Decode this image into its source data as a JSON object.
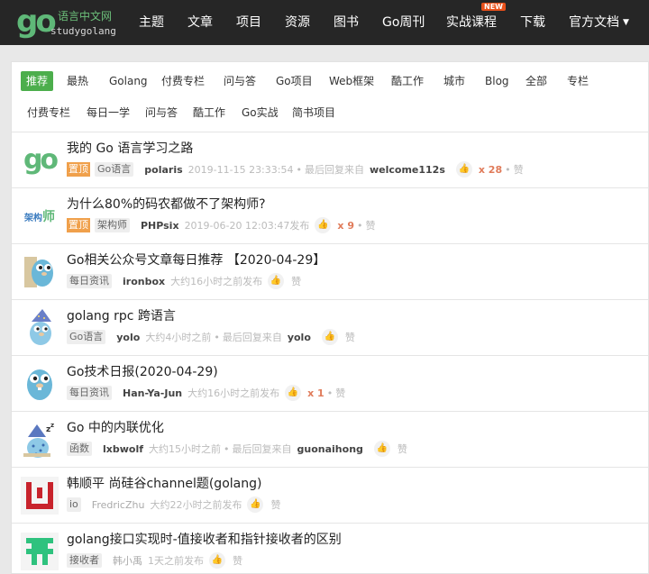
{
  "brand": {
    "logo_mark": "go",
    "name_cn": "语言中文网",
    "name_en": "studygolang"
  },
  "nav": {
    "items": [
      "主题",
      "文章",
      "项目",
      "资源",
      "图书",
      "Go周刊",
      "实战课程",
      "下载",
      "官方文档"
    ],
    "new_badge": "NEW"
  },
  "tabs_primary": [
    "推荐",
    "最热",
    "Golang",
    "付费专栏",
    "问与答",
    "Go项目",
    "Web框架",
    "酷工作",
    "城市",
    "Blog",
    "全部",
    "专栏"
  ],
  "tabs_secondary": [
    "付费专栏",
    "每日一学",
    "问与答",
    "酷工作",
    "Go实战",
    "简书项目"
  ],
  "topics": [
    {
      "avatar": "go-logo-avatar",
      "title": "我的 Go 语言学习之路",
      "pinned": "置顶",
      "node": "Go语言",
      "author": "polaris",
      "time": "2019-11-15 23:33:54",
      "sep": "•",
      "status": "最后回复来自",
      "last_reply": "welcome112s",
      "likes": "x 28",
      "zan": "赞"
    },
    {
      "avatar": "architect-avatar",
      "avatar_text_1": "架构",
      "avatar_text_2": "师",
      "title": "为什么80%的码农都做不了架构师?",
      "pinned": "置顶",
      "node": "架构师",
      "author": "PHPsix",
      "time": "2019-06-20 12:03:47发布",
      "likes": "x 9",
      "sep": "•",
      "zan": "赞"
    },
    {
      "avatar": "gopher-door-avatar",
      "title": "Go相关公众号文章每日推荐 【2020-04-29】",
      "node": "每日资讯",
      "author": "ironbox",
      "time": "大约16小时之前发布",
      "zan": "赞"
    },
    {
      "avatar": "gopher-wizard-avatar",
      "title": "golang rpc 跨语言",
      "node": "Go语言",
      "author": "yolo",
      "time": "大约4小时之前",
      "status": "最后回复来自",
      "last_reply": "yolo",
      "zan": "赞"
    },
    {
      "avatar": "gopher-avatar",
      "title": "Go技术日报(2020-04-29)",
      "node": "每日资讯",
      "author": "Han-Ya-Jun",
      "time": "大约16小时之前发布",
      "likes": "x 1",
      "sep": "•",
      "zan": "赞"
    },
    {
      "avatar": "gopher-sleep-avatar",
      "title": "Go 中的内联优化",
      "node": "函数",
      "author": "lxbwolf",
      "time": "大约15小时之前",
      "status": "最后回复来自",
      "last_reply": "guonaihong",
      "zan": "赞"
    },
    {
      "avatar": "pixel-red-avatar",
      "title": "韩顺平 尚硅谷channel题(golang)",
      "node": "io",
      "author": "FredricZhu",
      "time": "大约22小时之前发布",
      "zan": "赞"
    },
    {
      "avatar": "pixel-green-avatar",
      "title": "golang接口实现时-值接收者和指针接收者的区别",
      "node": "接收者",
      "author": "韩小禹",
      "time": "1天之前发布",
      "zan": "赞"
    }
  ],
  "colors": {
    "nav_bg": "#262626",
    "accent": "#4cae4c",
    "like": "#e07b5a",
    "pin": "#f0a04b"
  }
}
